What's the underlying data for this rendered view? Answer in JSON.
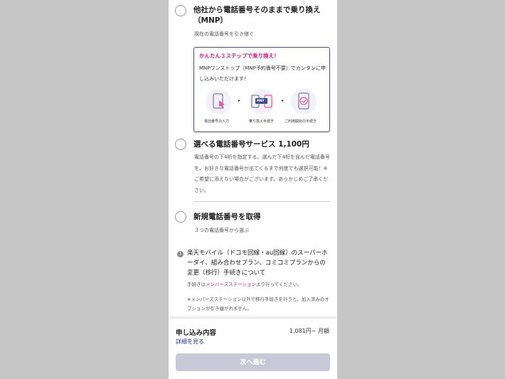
{
  "options": [
    {
      "title_line1": "他社から電話番号そのままで乗り換え",
      "title_line2": "（MNP）",
      "subtitle": "現在の電話番号を引き継ぐ"
    },
    {
      "title": "選べる電話番号サービス 1,100円",
      "description": "電話番号の下4桁を指定する。選んだ下4桁を含んだ電話番号を、お好きな電話番号が出てくるまで何度でも選択可能！※ご希望に添えない場合がございます。あらかじめご了承ください。"
    },
    {
      "title": "新規電話番号を取得",
      "subtitle": "３つの電話番号から選ぶ"
    }
  ],
  "mnp_box": {
    "headline": "かんたん３ステップで乗り換え！",
    "text": "MNPワンストップ（MNP予約番号不要）でカンタンに申し込みいただけます！",
    "steps": [
      {
        "icon": "phone-tap-icon",
        "label": "電話番号の入力"
      },
      {
        "icon": "mnp-transfer-icon",
        "label": "乗り換え手続き"
      },
      {
        "icon": "phone-check-icon",
        "label": "ご利用開始の手続き"
      }
    ],
    "mnp_badge": "MNP",
    "arrow": "▸",
    "accent_color": "#e0197d"
  },
  "info": {
    "icon": "i",
    "title": "楽天モバイル（ドコモ回線・au回線）のスーパーホーダイ、組み合わせプラン、コミコミプランからの変更（移行）手続きについて",
    "note_prefix": "手続きは",
    "note_link": "メンバーズステーション",
    "note_suffix": "より行ってください。",
    "caution": "※メンバーズステーション以外で移行手続きを行うと、加入済みのオプションが引き継がれません。"
  },
  "footer": {
    "title": "申し込み内容",
    "price": "1,081円~ 月額",
    "details_link": "詳細を見る",
    "next_button": "次へ進む"
  }
}
